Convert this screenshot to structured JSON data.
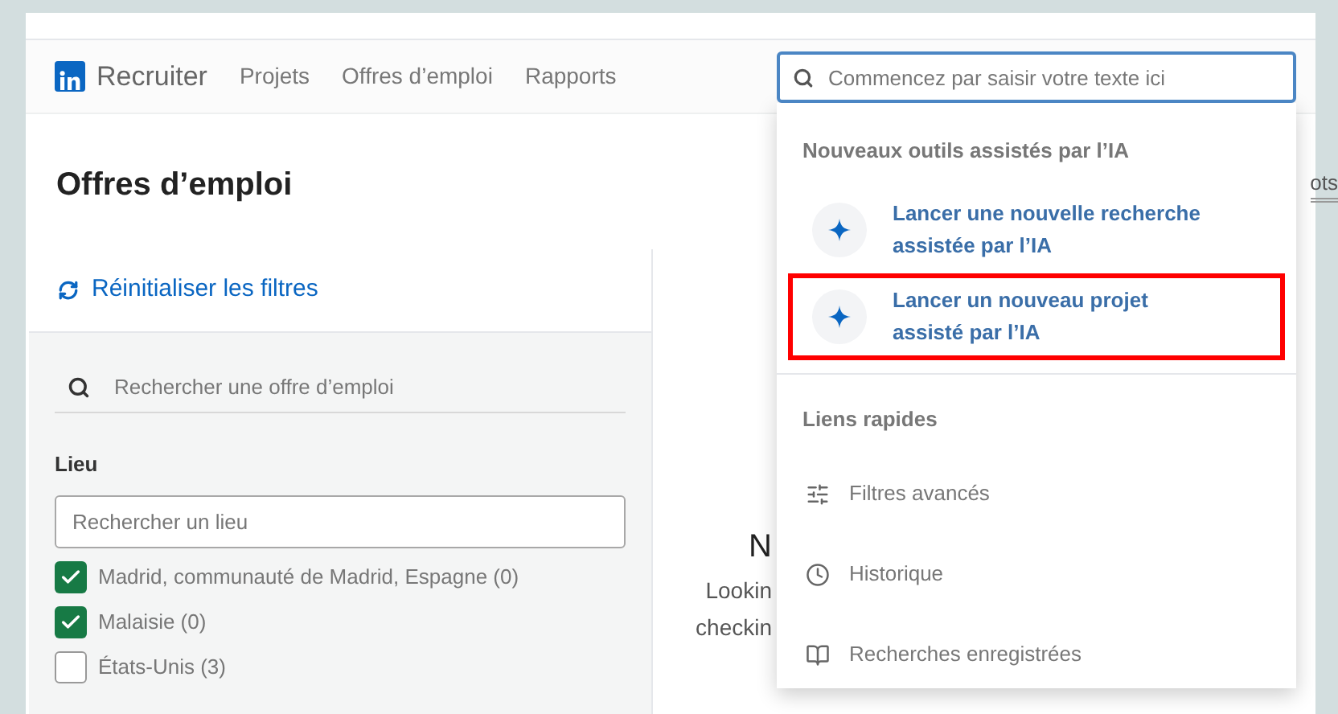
{
  "nav": {
    "product": "Recruiter",
    "links": [
      {
        "label": "Projets"
      },
      {
        "label": "Offres d’emploi"
      },
      {
        "label": "Rapports"
      }
    ],
    "search": {
      "placeholder": "Commencez par saisir votre texte ici"
    }
  },
  "page_title": "Offres d’emploi",
  "tab_fragment": "ots",
  "filters": {
    "reset": "Réinitialiser les filtres",
    "job_search": {
      "placeholder": "Rechercher une offre d’emploi"
    },
    "location": {
      "label": "Lieu",
      "placeholder": "Rechercher un lieu",
      "options": [
        {
          "label": "Madrid, communauté de Madrid, Espagne (0)",
          "checked": true
        },
        {
          "label": "Malaisie (0)",
          "checked": true
        },
        {
          "label": "États-Unis (3)",
          "checked": false
        }
      ]
    }
  },
  "empty_state": {
    "title": "N",
    "lines": [
      "Lookin",
      "checkin"
    ]
  },
  "dropdown": {
    "sections": [
      {
        "title": "Nouveaux outils assistés par l’IA",
        "items": [
          {
            "kind": "ai",
            "label": "Lancer une nouvelle recherche assistée par l’IA",
            "highlighted": false
          },
          {
            "kind": "ai",
            "label": "Lancer un nouveau projet assisté par l’IA",
            "highlighted": true
          }
        ]
      },
      {
        "title": "Liens rapides",
        "items": [
          {
            "kind": "filters",
            "label": "Filtres avancés",
            "highlighted": false
          },
          {
            "kind": "history",
            "label": "Historique",
            "highlighted": false
          },
          {
            "kind": "saved",
            "label": "Recherches enregistrées",
            "highlighted": false
          }
        ]
      }
    ]
  }
}
